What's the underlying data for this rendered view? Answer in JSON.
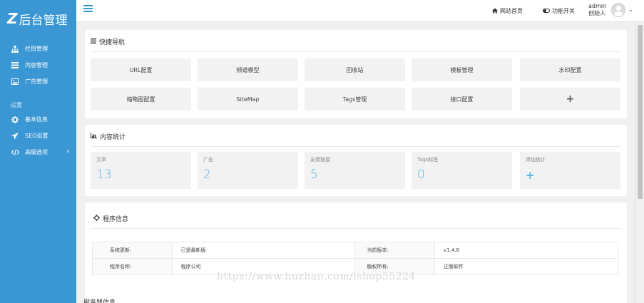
{
  "app": {
    "logo_mark": "Z",
    "logo_text": "后台管理"
  },
  "sidebar": {
    "items": [
      {
        "label": "栏目管理",
        "icon": "sitemap-icon"
      },
      {
        "label": "内容管理",
        "icon": "list-icon"
      },
      {
        "label": "广告管理",
        "icon": "image-icon"
      }
    ],
    "section_label": "设置",
    "settings_items": [
      {
        "label": "基本信息",
        "icon": "gear-icon"
      },
      {
        "label": "SEO设置",
        "icon": "paper-plane-icon"
      },
      {
        "label": "高级选项",
        "icon": "code-icon",
        "chevron": "›"
      }
    ]
  },
  "topbar": {
    "home_label": "网站首页",
    "toggle_label": "功能开关",
    "user_name": "admin",
    "user_role": "创始人",
    "caret": "⌄"
  },
  "quick_nav": {
    "title": "快捷导航",
    "buttons": [
      "URL配置",
      "频道模型",
      "回收站",
      "模板管理",
      "水印配置",
      "缩略图配置",
      "SiteMap",
      "Tags管理",
      "接口配置",
      "+"
    ]
  },
  "stats": {
    "title": "内容统计",
    "boxes": [
      {
        "label": "文章",
        "value": "13"
      },
      {
        "label": "广告",
        "value": "2"
      },
      {
        "label": "友情链接",
        "value": "5"
      },
      {
        "label": "Tags标签",
        "value": "0"
      },
      {
        "label": "添加统计",
        "value": "+"
      }
    ]
  },
  "program_info": {
    "title": "程序信息",
    "rows": [
      {
        "k1": "系统更新:",
        "v1": "已是最新版",
        "k2": "当前版本:",
        "v2": "v1.4.8"
      },
      {
        "k1": "程序名称:",
        "v1": "程序公司",
        "k2": "版权所有:",
        "v2": "正版软件"
      }
    ]
  },
  "watermark": "https://www.huzhan.com/ishop55224",
  "next_panel_title": "服务器信息",
  "colors": {
    "sidebar": "#3a97d4",
    "accent": "#4fb0e8"
  }
}
